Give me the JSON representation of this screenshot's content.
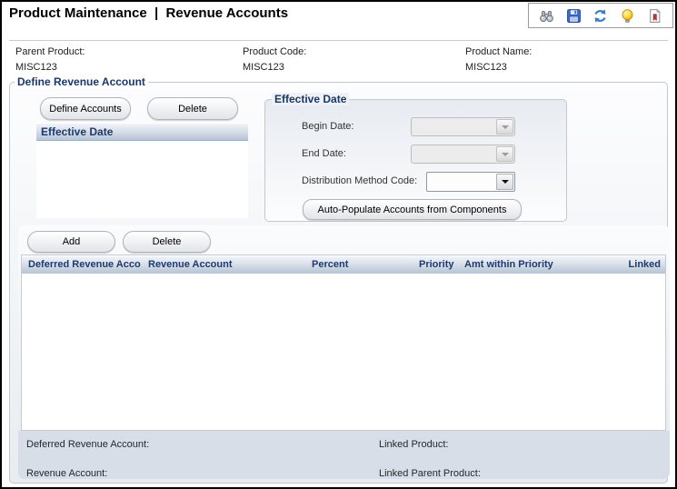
{
  "title": "Product Maintenance  |  Revenue Accounts",
  "toolbar": {
    "icons": [
      {
        "name": "find-binoculars-icon"
      },
      {
        "name": "save-icon"
      },
      {
        "name": "refresh-icon"
      },
      {
        "name": "tip-lightbulb-icon"
      },
      {
        "name": "report-icon"
      }
    ]
  },
  "product_info": {
    "fields": [
      {
        "label": "Parent Product:",
        "value": "MISC123"
      },
      {
        "label": "Product Code:",
        "value": "MISC123"
      },
      {
        "label": "Product Name:",
        "value": "MISC123"
      }
    ]
  },
  "define_revenue_account": {
    "legend": "Define Revenue Account",
    "define_accounts_button": "Define Accounts",
    "delete_button": "Delete",
    "effective_date_list": {
      "header": "Effective Date",
      "rows": []
    },
    "effective_date_panel": {
      "legend": "Effective Date",
      "begin_date": {
        "label": "Begin Date:",
        "value": "",
        "disabled": true
      },
      "end_date": {
        "label": "End Date:",
        "value": "",
        "disabled": true
      },
      "distribution_method_code": {
        "label": "Distribution Method Code:",
        "value": "",
        "disabled": false
      },
      "auto_populate_button": "Auto-Populate Accounts from Components"
    },
    "accounts": {
      "add_button": "Add",
      "delete_button": "Delete",
      "grid": {
        "columns": [
          "Deferred Revenue Acco",
          "Revenue Account",
          "Percent",
          "Priority",
          "Amt within Priority",
          "Linked"
        ],
        "rows": []
      },
      "summary": {
        "deferred_revenue_account": {
          "label": "Deferred Revenue Account:",
          "value": ""
        },
        "revenue_account": {
          "label": "Revenue Account:",
          "value": ""
        },
        "linked_product": {
          "label": "Linked Product:",
          "value": ""
        },
        "linked_parent_product": {
          "label": "Linked Parent Product:",
          "value": ""
        }
      }
    }
  },
  "colors": {
    "accent_navy": "#1c3a6e",
    "grid_header_top": "#f4f7fa",
    "grid_header_bottom": "#b7c4d4",
    "summary_bg": "#d8dee8",
    "window_border": "#000000"
  }
}
